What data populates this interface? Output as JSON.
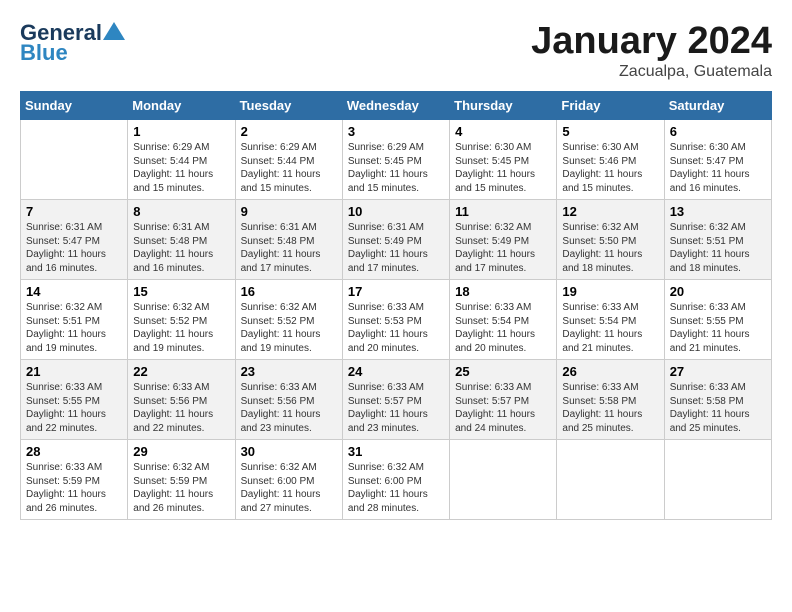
{
  "logo": {
    "general": "General",
    "blue": "Blue"
  },
  "title": "January 2024",
  "subtitle": "Zacualpa, Guatemala",
  "weekdays": [
    "Sunday",
    "Monday",
    "Tuesday",
    "Wednesday",
    "Thursday",
    "Friday",
    "Saturday"
  ],
  "weeks": [
    [
      {
        "day": "",
        "info": ""
      },
      {
        "day": "1",
        "info": "Sunrise: 6:29 AM\nSunset: 5:44 PM\nDaylight: 11 hours\nand 15 minutes."
      },
      {
        "day": "2",
        "info": "Sunrise: 6:29 AM\nSunset: 5:44 PM\nDaylight: 11 hours\nand 15 minutes."
      },
      {
        "day": "3",
        "info": "Sunrise: 6:29 AM\nSunset: 5:45 PM\nDaylight: 11 hours\nand 15 minutes."
      },
      {
        "day": "4",
        "info": "Sunrise: 6:30 AM\nSunset: 5:45 PM\nDaylight: 11 hours\nand 15 minutes."
      },
      {
        "day": "5",
        "info": "Sunrise: 6:30 AM\nSunset: 5:46 PM\nDaylight: 11 hours\nand 15 minutes."
      },
      {
        "day": "6",
        "info": "Sunrise: 6:30 AM\nSunset: 5:47 PM\nDaylight: 11 hours\nand 16 minutes."
      }
    ],
    [
      {
        "day": "7",
        "info": "Sunrise: 6:31 AM\nSunset: 5:47 PM\nDaylight: 11 hours\nand 16 minutes."
      },
      {
        "day": "8",
        "info": "Sunrise: 6:31 AM\nSunset: 5:48 PM\nDaylight: 11 hours\nand 16 minutes."
      },
      {
        "day": "9",
        "info": "Sunrise: 6:31 AM\nSunset: 5:48 PM\nDaylight: 11 hours\nand 17 minutes."
      },
      {
        "day": "10",
        "info": "Sunrise: 6:31 AM\nSunset: 5:49 PM\nDaylight: 11 hours\nand 17 minutes."
      },
      {
        "day": "11",
        "info": "Sunrise: 6:32 AM\nSunset: 5:49 PM\nDaylight: 11 hours\nand 17 minutes."
      },
      {
        "day": "12",
        "info": "Sunrise: 6:32 AM\nSunset: 5:50 PM\nDaylight: 11 hours\nand 18 minutes."
      },
      {
        "day": "13",
        "info": "Sunrise: 6:32 AM\nSunset: 5:51 PM\nDaylight: 11 hours\nand 18 minutes."
      }
    ],
    [
      {
        "day": "14",
        "info": "Sunrise: 6:32 AM\nSunset: 5:51 PM\nDaylight: 11 hours\nand 19 minutes."
      },
      {
        "day": "15",
        "info": "Sunrise: 6:32 AM\nSunset: 5:52 PM\nDaylight: 11 hours\nand 19 minutes."
      },
      {
        "day": "16",
        "info": "Sunrise: 6:32 AM\nSunset: 5:52 PM\nDaylight: 11 hours\nand 19 minutes."
      },
      {
        "day": "17",
        "info": "Sunrise: 6:33 AM\nSunset: 5:53 PM\nDaylight: 11 hours\nand 20 minutes."
      },
      {
        "day": "18",
        "info": "Sunrise: 6:33 AM\nSunset: 5:54 PM\nDaylight: 11 hours\nand 20 minutes."
      },
      {
        "day": "19",
        "info": "Sunrise: 6:33 AM\nSunset: 5:54 PM\nDaylight: 11 hours\nand 21 minutes."
      },
      {
        "day": "20",
        "info": "Sunrise: 6:33 AM\nSunset: 5:55 PM\nDaylight: 11 hours\nand 21 minutes."
      }
    ],
    [
      {
        "day": "21",
        "info": "Sunrise: 6:33 AM\nSunset: 5:55 PM\nDaylight: 11 hours\nand 22 minutes."
      },
      {
        "day": "22",
        "info": "Sunrise: 6:33 AM\nSunset: 5:56 PM\nDaylight: 11 hours\nand 22 minutes."
      },
      {
        "day": "23",
        "info": "Sunrise: 6:33 AM\nSunset: 5:56 PM\nDaylight: 11 hours\nand 23 minutes."
      },
      {
        "day": "24",
        "info": "Sunrise: 6:33 AM\nSunset: 5:57 PM\nDaylight: 11 hours\nand 23 minutes."
      },
      {
        "day": "25",
        "info": "Sunrise: 6:33 AM\nSunset: 5:57 PM\nDaylight: 11 hours\nand 24 minutes."
      },
      {
        "day": "26",
        "info": "Sunrise: 6:33 AM\nSunset: 5:58 PM\nDaylight: 11 hours\nand 25 minutes."
      },
      {
        "day": "27",
        "info": "Sunrise: 6:33 AM\nSunset: 5:58 PM\nDaylight: 11 hours\nand 25 minutes."
      }
    ],
    [
      {
        "day": "28",
        "info": "Sunrise: 6:33 AM\nSunset: 5:59 PM\nDaylight: 11 hours\nand 26 minutes."
      },
      {
        "day": "29",
        "info": "Sunrise: 6:32 AM\nSunset: 5:59 PM\nDaylight: 11 hours\nand 26 minutes."
      },
      {
        "day": "30",
        "info": "Sunrise: 6:32 AM\nSunset: 6:00 PM\nDaylight: 11 hours\nand 27 minutes."
      },
      {
        "day": "31",
        "info": "Sunrise: 6:32 AM\nSunset: 6:00 PM\nDaylight: 11 hours\nand 28 minutes."
      },
      {
        "day": "",
        "info": ""
      },
      {
        "day": "",
        "info": ""
      },
      {
        "day": "",
        "info": ""
      }
    ]
  ]
}
